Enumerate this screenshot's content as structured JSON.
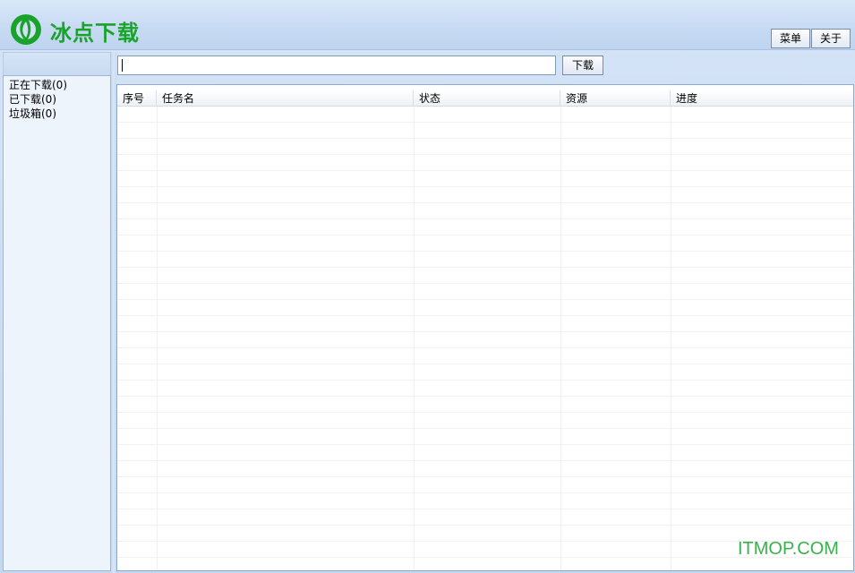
{
  "app": {
    "title": "冰点下载",
    "brand_color": "#1aa32b"
  },
  "toolbar": {
    "menu_label": "菜单",
    "about_label": "关于"
  },
  "url_bar": {
    "value": "",
    "download_label": "下载"
  },
  "sidebar": {
    "items": [
      {
        "label": "正在下载(0)"
      },
      {
        "label": "已下载(0)"
      },
      {
        "label": "垃圾箱(0)"
      }
    ]
  },
  "table": {
    "columns": [
      {
        "label": "序号"
      },
      {
        "label": "任务名"
      },
      {
        "label": "状态"
      },
      {
        "label": "资源"
      },
      {
        "label": "进度"
      }
    ],
    "rows": []
  },
  "watermark": "ITMOP.COM"
}
